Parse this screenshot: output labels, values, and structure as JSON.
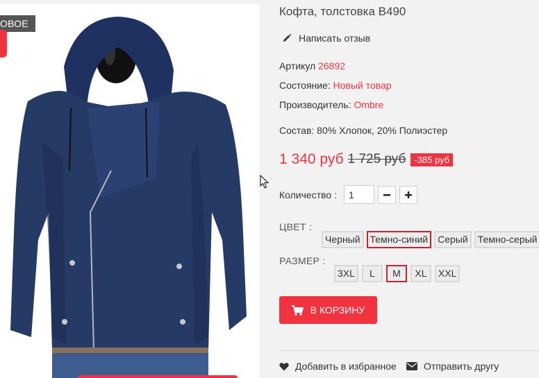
{
  "product": {
    "badge_new": "ОВОЕ",
    "title": "Кофта, толстовка B490",
    "review_link": "Написать отзыв",
    "sku_label": "Артикул",
    "sku_value": "26892",
    "condition_label": "Состояние:",
    "condition_value": "Новый товар",
    "maker_label": "Производитель:",
    "maker_value": "Ombre",
    "composition": "Состав: 80% Хлопок, 20% Полиэстер",
    "price_new": "1 340 руб",
    "price_old": "1 725 руб",
    "discount": "-385 руб"
  },
  "quantity": {
    "label": "Количество :",
    "value": "1"
  },
  "color": {
    "label": "ЦВЕТ :",
    "options": [
      "Черный",
      "Темно-синий",
      "Серый",
      "Темно-серый"
    ],
    "selected": "Темно-синий"
  },
  "size": {
    "label": "РАЗМЕР :",
    "options": [
      "3XL",
      "L",
      "M",
      "XL",
      "XXL"
    ],
    "selected": "M"
  },
  "actions": {
    "add_to_cart": "В КОРЗИНУ",
    "favorite": "Добавить в избранное",
    "send_friend": "Отправить другу"
  },
  "colors": {
    "accent": "#f13340",
    "selected_border": "#c8202e",
    "jacket": "#263a66"
  }
}
